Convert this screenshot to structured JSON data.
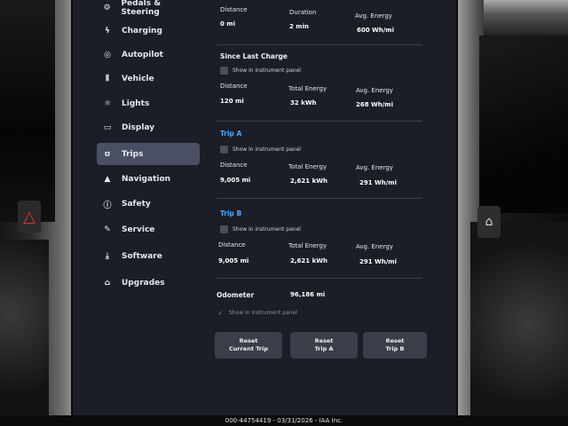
{
  "sidebar": {
    "items": [
      {
        "label": "Pedals & Steering",
        "icon": "steering-pedal-icon"
      },
      {
        "label": "Charging",
        "icon": "lightning-icon"
      },
      {
        "label": "Autopilot",
        "icon": "steering-wheel-icon"
      },
      {
        "label": "Vehicle",
        "icon": "vehicle-bars-icon"
      },
      {
        "label": "Lights",
        "icon": "light-bulb-icon"
      },
      {
        "label": "Display",
        "icon": "display-icon"
      },
      {
        "label": "Trips",
        "icon": "trips-icon",
        "active": true
      },
      {
        "label": "Navigation",
        "icon": "navigation-arrow-icon"
      },
      {
        "label": "Safety",
        "icon": "info-circle-icon"
      },
      {
        "label": "Service",
        "icon": "wrench-icon"
      },
      {
        "label": "Software",
        "icon": "download-icon"
      },
      {
        "label": "Upgrades",
        "icon": "bag-icon"
      }
    ]
  },
  "current_drive": {
    "distance_label": "Distance",
    "distance_value": "0 mi",
    "duration_label": "Duration",
    "duration_value": "2 min",
    "energy_label": "Avg. Energy",
    "energy_value": "600 Wh/mi"
  },
  "since_last_charge": {
    "title": "Since Last Charge",
    "checkbox_label": "Show in instrument panel",
    "distance_label": "Distance",
    "distance_value": "120 mi",
    "total_label": "Total Energy",
    "total_value": "32 kWh",
    "avg_label": "Avg. Energy",
    "avg_value": "268 Wh/mi"
  },
  "trip_a": {
    "title": "Trip A",
    "checkbox_label": "Show in instrument panel",
    "distance_label": "Distance",
    "distance_value": "9,005 mi",
    "total_label": "Total Energy",
    "total_value": "2,621 kWh",
    "avg_label": "Avg. Energy",
    "avg_value": "291 Wh/mi"
  },
  "trip_b": {
    "title": "Trip B",
    "checkbox_label": "Show in instrument panel",
    "distance_label": "Distance",
    "distance_value": "9,005 mi",
    "total_label": "Total Energy",
    "total_value": "2,621 kWh",
    "avg_label": "Avg. Energy",
    "avg_value": "291 Wh/mi"
  },
  "odometer": {
    "label": "Odometer",
    "value": "96,186 mi",
    "checkbox_label": "Show in instrument panel",
    "checked": true
  },
  "buttons": {
    "reset_current_line1": "Reset",
    "reset_current_line2": "Current Trip",
    "reset_a_line1": "Reset",
    "reset_a_line2": "Trip A",
    "reset_b_line1": "Reset",
    "reset_b_line2": "Trip B"
  },
  "footer": {
    "text": "000-44754419 - 03/31/2026 - IAA Inc."
  },
  "colors": {
    "screen_bg": "#1b1e27",
    "active_item_bg": "#4a5063",
    "trip_title_blue": "#4aa8ff",
    "button_bg": "#3a3e49"
  }
}
